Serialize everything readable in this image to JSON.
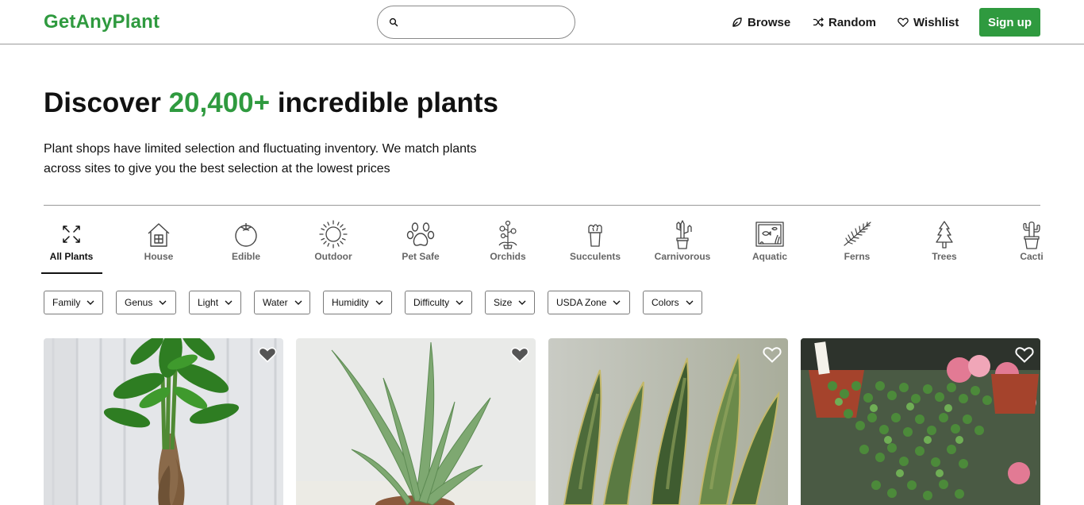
{
  "header": {
    "logo": "GetAnyPlant",
    "search_placeholder": "",
    "nav": [
      {
        "label": "Browse",
        "icon": "leaf-icon"
      },
      {
        "label": "Random",
        "icon": "shuffle-icon"
      },
      {
        "label": "Wishlist",
        "icon": "heart-icon"
      }
    ],
    "signup_label": "Sign up",
    "accent_color": "#2f9a3f"
  },
  "hero": {
    "title_before": "Discover ",
    "title_accent": "20,400+",
    "title_after": " incredible plants",
    "description": "Plant shops have limited selection and fluctuating inventory. We match plants across sites to give you the best selection at the lowest prices"
  },
  "categories": [
    {
      "label": "All Plants",
      "icon": "expand-arrows-icon",
      "active": true
    },
    {
      "label": "House",
      "icon": "house-icon",
      "active": false
    },
    {
      "label": "Edible",
      "icon": "tomato-icon",
      "active": false
    },
    {
      "label": "Outdoor",
      "icon": "sun-icon",
      "active": false
    },
    {
      "label": "Pet Safe",
      "icon": "paw-icon",
      "active": false
    },
    {
      "label": "Orchids",
      "icon": "orchid-icon",
      "active": false
    },
    {
      "label": "Succulents",
      "icon": "succulent-icon",
      "active": false
    },
    {
      "label": "Carnivorous",
      "icon": "carnivorous-plant-icon",
      "active": false
    },
    {
      "label": "Aquatic",
      "icon": "aquarium-icon",
      "active": false
    },
    {
      "label": "Ferns",
      "icon": "fern-icon",
      "active": false
    },
    {
      "label": "Trees",
      "icon": "tree-icon",
      "active": false
    },
    {
      "label": "Cacti",
      "icon": "cactus-icon",
      "active": false
    }
  ],
  "filters": [
    "Family",
    "Genus",
    "Light",
    "Water",
    "Humidity",
    "Difficulty",
    "Size",
    "USDA Zone",
    "Colors"
  ],
  "products": [
    {
      "name": "money-tree",
      "wishlisted": true
    },
    {
      "name": "aloe",
      "wishlisted": true
    },
    {
      "name": "snake-plant",
      "wishlisted": false
    },
    {
      "name": "string-of-pearls",
      "wishlisted": false
    }
  ]
}
